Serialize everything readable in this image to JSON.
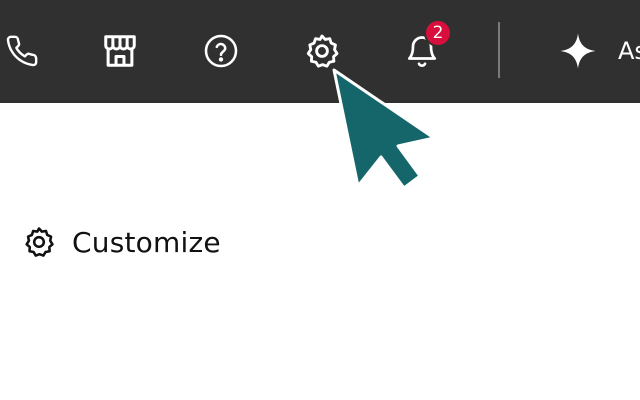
{
  "topbar": {
    "background": "#303030",
    "icons": [
      {
        "name": "phone-icon"
      },
      {
        "name": "store-icon"
      },
      {
        "name": "help-icon"
      },
      {
        "name": "settings-icon"
      },
      {
        "name": "notifications-icon"
      },
      {
        "name": "sparkle-icon"
      }
    ],
    "notifications_badge": "2",
    "badge_color": "#d80f3c",
    "assistant_label": "As"
  },
  "menu": {
    "customize_label": "Customize",
    "customize_icon": "gear-icon"
  },
  "cursor": {
    "color": "#15666a",
    "icon": "mouse-pointer-icon"
  }
}
